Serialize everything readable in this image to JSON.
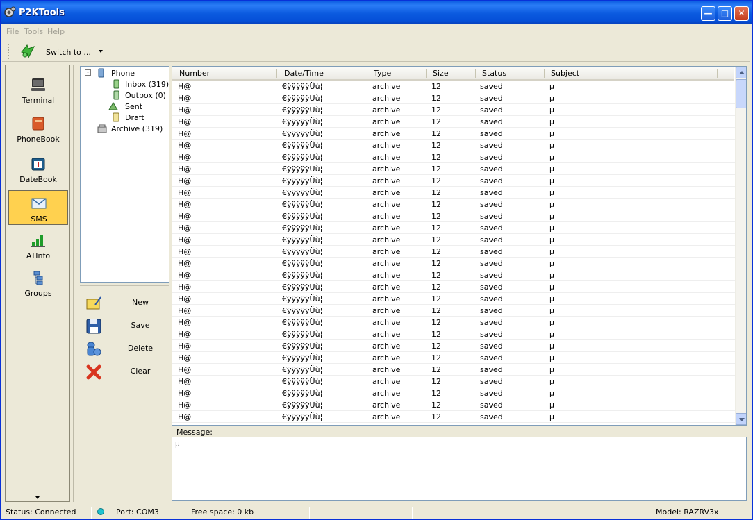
{
  "window": {
    "title": "P2KTools"
  },
  "menu": [
    "File",
    "Tools",
    "Help"
  ],
  "toolbar": {
    "switch_label": "Switch to ..."
  },
  "nav": {
    "items": [
      {
        "label": "Terminal",
        "icon": "terminal-icon",
        "active": false
      },
      {
        "label": "PhoneBook",
        "icon": "phonebook-icon",
        "active": false
      },
      {
        "label": "DateBook",
        "icon": "datebook-icon",
        "active": false
      },
      {
        "label": "SMS",
        "icon": "sms-envelope-icon",
        "active": true
      },
      {
        "label": "ATInfo",
        "icon": "atinfo-signal-icon",
        "active": false
      },
      {
        "label": "Groups",
        "icon": "groups-icon",
        "active": false
      }
    ]
  },
  "tree": {
    "root": "Phone",
    "children": [
      "Inbox (319)",
      "Outbox (0)",
      "Sent",
      "Draft"
    ],
    "archive": "Archive (319)"
  },
  "actions": [
    {
      "label": "New",
      "icon": "new-message-icon"
    },
    {
      "label": "Save",
      "icon": "save-floppy-icon"
    },
    {
      "label": "Delete",
      "icon": "delete-icon"
    },
    {
      "label": "Clear",
      "icon": "clear-x-icon"
    }
  ],
  "table": {
    "columns": [
      "Number",
      "Date/Time",
      "Type",
      "Size",
      "Status",
      "Subject"
    ],
    "rows": [
      [
        "H@",
        "€ÿÿÿÿÿÜù¦",
        "archive",
        "12",
        "saved",
        "µ"
      ],
      [
        "H@",
        "€ÿÿÿÿÿÜù¦",
        "archive",
        "12",
        "saved",
        "µ"
      ],
      [
        "H@",
        "€ÿÿÿÿÿÜù¦",
        "archive",
        "12",
        "saved",
        "µ"
      ],
      [
        "H@",
        "€ÿÿÿÿÿÜù¦",
        "archive",
        "12",
        "saved",
        "µ"
      ],
      [
        "H@",
        "€ÿÿÿÿÿÜù¦",
        "archive",
        "12",
        "saved",
        "µ"
      ],
      [
        "H@",
        "€ÿÿÿÿÿÜù¦",
        "archive",
        "12",
        "saved",
        "µ"
      ],
      [
        "H@",
        "€ÿÿÿÿÿÜù¦",
        "archive",
        "12",
        "saved",
        "µ"
      ],
      [
        "H@",
        "€ÿÿÿÿÿÜù¦",
        "archive",
        "12",
        "saved",
        "µ"
      ],
      [
        "H@",
        "€ÿÿÿÿÿÜù¦",
        "archive",
        "12",
        "saved",
        "µ"
      ],
      [
        "H@",
        "€ÿÿÿÿÿÜù¦",
        "archive",
        "12",
        "saved",
        "µ"
      ],
      [
        "H@",
        "€ÿÿÿÿÿÜù¦",
        "archive",
        "12",
        "saved",
        "µ"
      ],
      [
        "H@",
        "€ÿÿÿÿÿÜù¦",
        "archive",
        "12",
        "saved",
        "µ"
      ],
      [
        "H@",
        "€ÿÿÿÿÿÜù¦",
        "archive",
        "12",
        "saved",
        "µ"
      ],
      [
        "H@",
        "€ÿÿÿÿÿÜù¦",
        "archive",
        "12",
        "saved",
        "µ"
      ],
      [
        "H@",
        "€ÿÿÿÿÿÜù¦",
        "archive",
        "12",
        "saved",
        "µ"
      ],
      [
        "H@",
        "€ÿÿÿÿÿÜù¦",
        "archive",
        "12",
        "saved",
        "µ"
      ],
      [
        "H@",
        "€ÿÿÿÿÿÜù¦",
        "archive",
        "12",
        "saved",
        "µ"
      ],
      [
        "H@",
        "€ÿÿÿÿÿÜù¦",
        "archive",
        "12",
        "saved",
        "µ"
      ],
      [
        "H@",
        "€ÿÿÿÿÿÜù¦",
        "archive",
        "12",
        "saved",
        "µ"
      ],
      [
        "H@",
        "€ÿÿÿÿÿÜù¦",
        "archive",
        "12",
        "saved",
        "µ"
      ],
      [
        "H@",
        "€ÿÿÿÿÿÜù¦",
        "archive",
        "12",
        "saved",
        "µ"
      ],
      [
        "H@",
        "€ÿÿÿÿÿÜù¦",
        "archive",
        "12",
        "saved",
        "µ"
      ],
      [
        "H@",
        "€ÿÿÿÿÿÜù¦",
        "archive",
        "12",
        "saved",
        "µ"
      ],
      [
        "H@",
        "€ÿÿÿÿÿÜù¦",
        "archive",
        "12",
        "saved",
        "µ"
      ],
      [
        "H@",
        "€ÿÿÿÿÿÜù¦",
        "archive",
        "12",
        "saved",
        "µ"
      ],
      [
        "H@",
        "€ÿÿÿÿÿÜù¦",
        "archive",
        "12",
        "saved",
        "µ"
      ],
      [
        "H@",
        "€ÿÿÿÿÿÜù¦",
        "archive",
        "12",
        "saved",
        "µ"
      ],
      [
        "H@",
        "€ÿÿÿÿÿÜù¦",
        "archive",
        "12",
        "saved",
        "µ"
      ],
      [
        "H@",
        "€ÿÿÿÿÿÜù¦",
        "archive",
        "12",
        "saved",
        "µ"
      ]
    ]
  },
  "message": {
    "label": "Message:",
    "text": "µ"
  },
  "status": {
    "connection": "Status: Connected",
    "port": "Port: COM3",
    "free_space": "Free space: 0 kb",
    "model": "Model: RAZRV3x",
    "led_color": "#1fc2d0"
  }
}
